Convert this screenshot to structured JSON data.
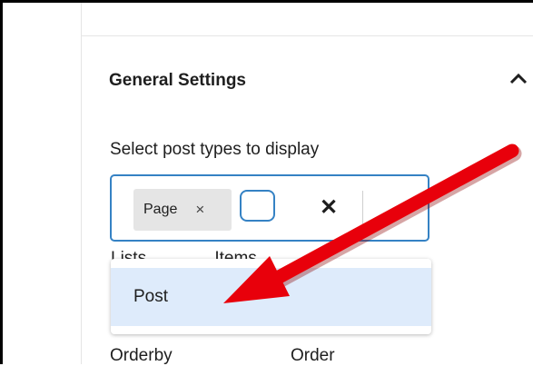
{
  "panel": {
    "section_title": "General Settings",
    "chevron_icon": "chevron-up-icon"
  },
  "post_types_field": {
    "label": "Select post types to display",
    "selected_chips": [
      {
        "label": "Page",
        "remove_glyph": "×"
      }
    ],
    "search_value": "",
    "clear_glyph": "✕"
  },
  "dropdown": {
    "options": [
      {
        "label": "Post",
        "highlighted": true
      }
    ]
  },
  "partially_hidden_labels": [
    "Lists",
    "Items"
  ],
  "next_fields": {
    "orderby_label": "Orderby",
    "order_label": "Order"
  },
  "annotation": {
    "arrow_color": "#e8000b"
  },
  "colors": {
    "accent": "#3582c4",
    "chip_bg": "#e5e5e5",
    "highlight_bg": "#deebfb"
  }
}
